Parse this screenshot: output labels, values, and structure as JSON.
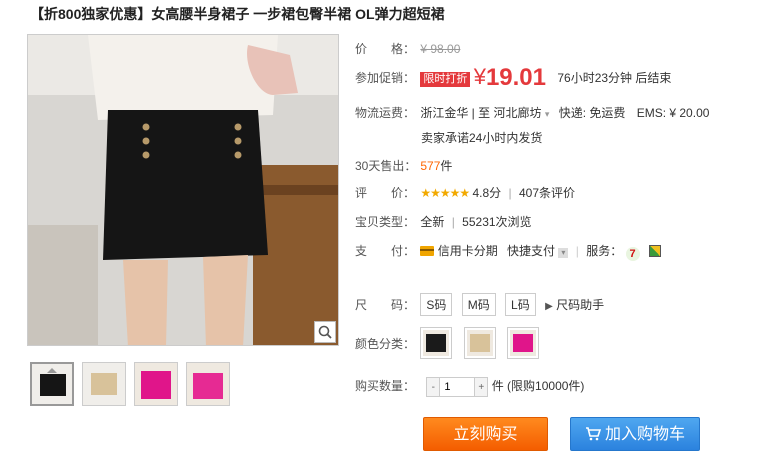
{
  "title": "【折800独家优惠】女高腰半身裙子 一步裙包臀半裙 OL弹力超短裙",
  "price": {
    "label": "价　　格：",
    "original": "¥ 98.00"
  },
  "promo": {
    "label": "参加促销：",
    "tag": "限时打折",
    "currency": "¥",
    "amount": "19.01",
    "countdown": "76小时23分钟 后结束"
  },
  "shipping": {
    "label": "物流运费：",
    "route": "浙江金华 | 至 河北廊坊",
    "express": "快递: 免运费",
    "ems": "EMS: ¥ 20.00",
    "promise": "卖家承诺24小时内发货"
  },
  "sales": {
    "label": "30天售出：",
    "count": "577",
    "unit": "件"
  },
  "rating": {
    "label": "评　　价：",
    "stars": "★★★★★",
    "score": "4.8分",
    "reviews": "407条评价"
  },
  "item_type": {
    "label": "宝贝类型：",
    "condition": "全新",
    "views": "55231次浏览"
  },
  "payment": {
    "label": "支　　付：",
    "credit": "信用卡分期",
    "quick": "快捷支付",
    "service_label": "服务："
  },
  "size": {
    "label": "尺　　码：",
    "options": [
      "S码",
      "M码",
      "L码"
    ],
    "helper": "尺码助手"
  },
  "color": {
    "label": "颜色分类："
  },
  "quantity": {
    "label": "购买数量：",
    "value": "1",
    "unit": "件",
    "limit": "(限购10000件)"
  },
  "buttons": {
    "buy": "立刻购买",
    "cart": "加入购物车"
  },
  "colors": {
    "accent": "#e4393c",
    "orange": "#ff6600",
    "blue": "#2b82de"
  }
}
